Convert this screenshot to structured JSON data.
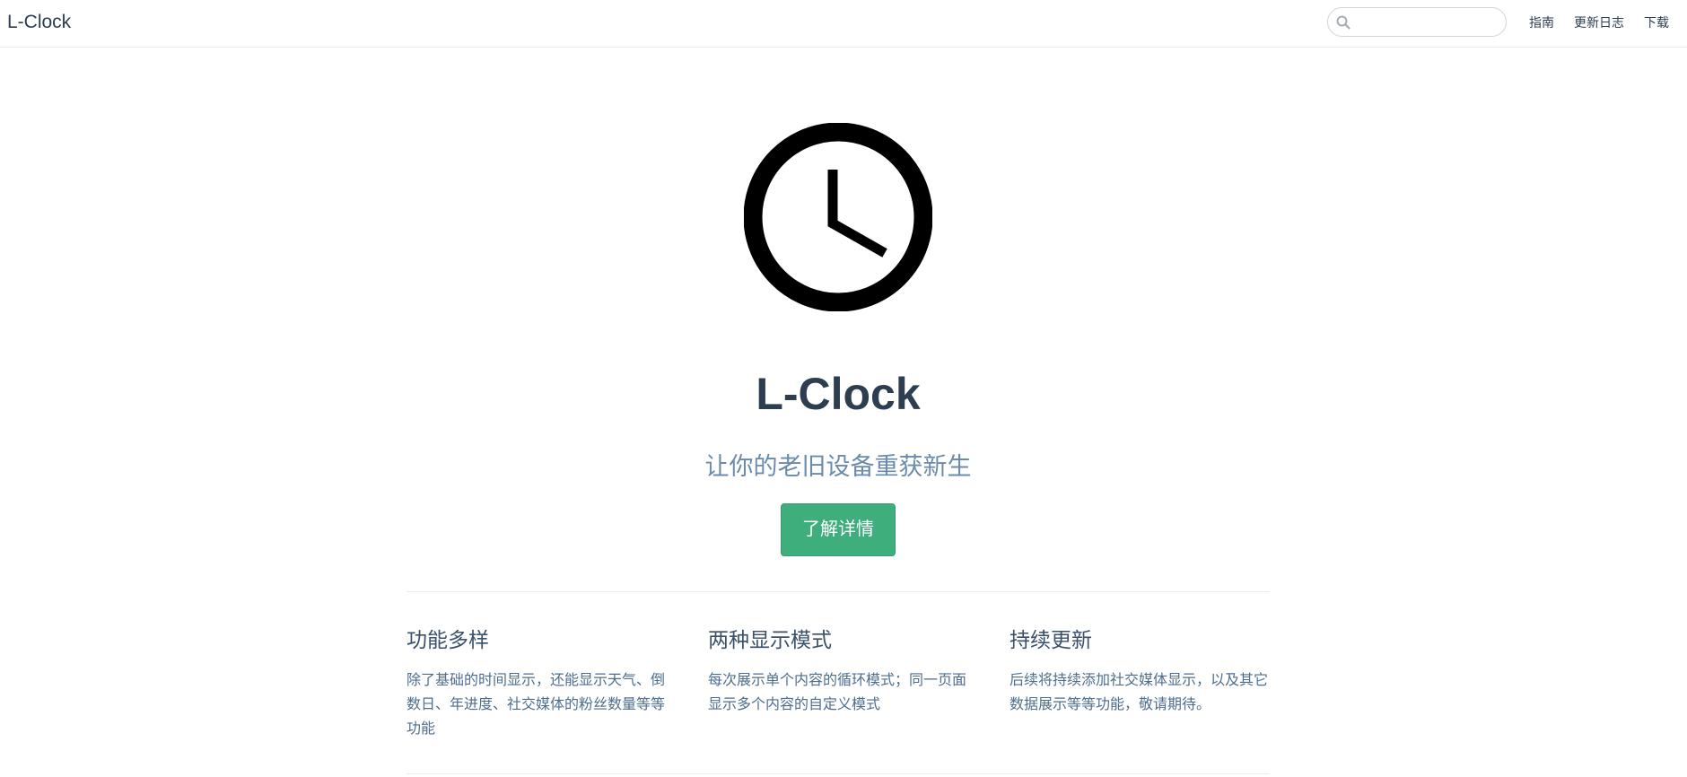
{
  "navbar": {
    "site_name": "L-Clock",
    "search": {
      "value": "",
      "placeholder": ""
    },
    "links": [
      {
        "label": "指南"
      },
      {
        "label": "更新日志"
      },
      {
        "label": "下载"
      }
    ]
  },
  "hero": {
    "logo_icon": "clock-icon",
    "title": "L-Clock",
    "description": "让你的老旧设备重获新生",
    "action_label": "了解详情",
    "action_color": "#3eaf7c"
  },
  "features": [
    {
      "title": "功能多样",
      "details": "除了基础的时间显示，还能显示天气、倒数日、年进度、社交媒体的粉丝数量等等功能"
    },
    {
      "title": "两种显示模式",
      "details": "每次展示单个内容的循环模式；同一页面显示多个内容的自定义模式"
    },
    {
      "title": "持续更新",
      "details": "后续将持续添加社交媒体显示，以及其它数据展示等等功能，敬请期待。"
    }
  ]
}
